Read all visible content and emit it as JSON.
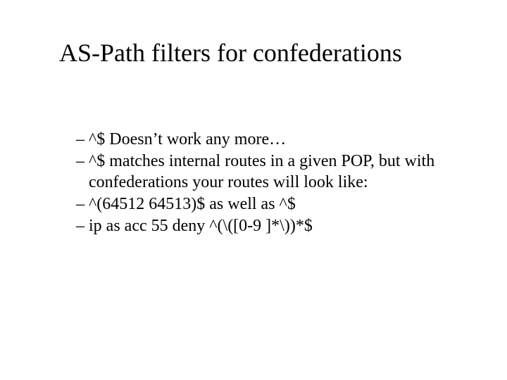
{
  "title": "AS-Path filters for confederations",
  "bullets": [
    "^$ Doesn’t work any more…",
    "^$ matches internal routes in a given POP, but with confederations your routes will look like:",
    "^(64512 64513)$ as well as ^$",
    "ip as acc 55 deny ^(\\([0-9 ]*\\))*$"
  ]
}
